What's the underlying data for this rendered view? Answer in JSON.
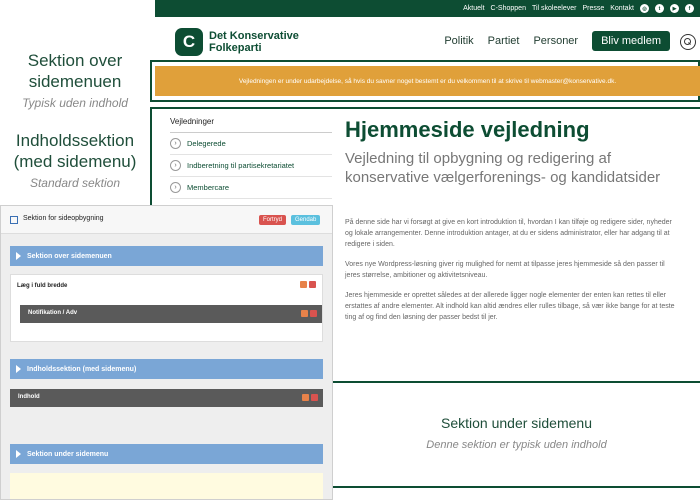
{
  "annotations": {
    "over": {
      "title": "Sektion over sidemenuen",
      "subtitle": "Typisk uden indhold"
    },
    "content": {
      "title": "Indholdssektion (med sidemenu)",
      "subtitle": "Standard sektion"
    },
    "under": {
      "title": "Sektion under sidemenu",
      "subtitle": "Denne sektion er typisk uden indhold"
    }
  },
  "topbar": {
    "links": [
      "Aktuelt",
      "C-Shoppen",
      "Til skoleelever",
      "Presse",
      "Kontakt"
    ],
    "social": [
      "instagram-icon",
      "twitter-icon",
      "youtube-icon",
      "facebook-icon"
    ]
  },
  "header": {
    "logo_letter": "C",
    "logo_line1": "Det Konservative",
    "logo_line2": "Folkeparti",
    "nav": [
      "Politik",
      "Partiet",
      "Personer"
    ],
    "cta": "Bliv medlem"
  },
  "banner": {
    "text": "Vejledningen er under udarbejdelse, så hvis du savner noget bestemt er du velkommen til at skrive til webmaster@konservative.dk."
  },
  "sidemenu": {
    "title": "Vejledninger",
    "items": [
      "Delegerede",
      "Indberetning til partisekretariatet",
      "Membercare"
    ]
  },
  "content": {
    "title": "Hjemmeside vejledning",
    "subtitle": "Vejledning til opbygning og redigering af konservative vælgerforenings- og kandidatsider",
    "paragraphs": [
      "På denne side har vi forsøgt at give en kort introduktion til, hvordan I kan tilføje og redigere sider, nyheder og lokale arrangementer. Denne introduktion antager, at du er sidens administrator, eller har adgang til at redigere i siden.",
      "Vores nye Wordpress-løsning giver rig mulighed for nemt at tilpasse jeres hjemmeside så den passer til jeres størrelse, ambitioner og aktivitetsniveau.",
      "Jeres hjemmeside er oprettet således at der allerede ligger nogle elementer der enten kan rettes til eller erstattes af andre elementer. Alt indhold kan altid ændres eller rulles tilbage, så vær ikke bange for at teste ting af og find den løsning der passer bedst til jer."
    ]
  },
  "builder": {
    "title": "Sektion for sideopbygning",
    "btn_revert": "Fortryd",
    "btn_restore": "Gendab",
    "bar_over": "Sektion over sidemenuen",
    "row_full": "Læg i fuld bredde",
    "module_notification": "Notifikation / Adv",
    "bar_content": "Indholdssektion (med sidemenu)",
    "module_content": "Indhold",
    "bar_under": "Sektion under sidemenu"
  },
  "colors": {
    "brand_green": "#0d4d33",
    "banner_orange": "#e0a03a",
    "builder_blue": "#7aa6d6"
  }
}
